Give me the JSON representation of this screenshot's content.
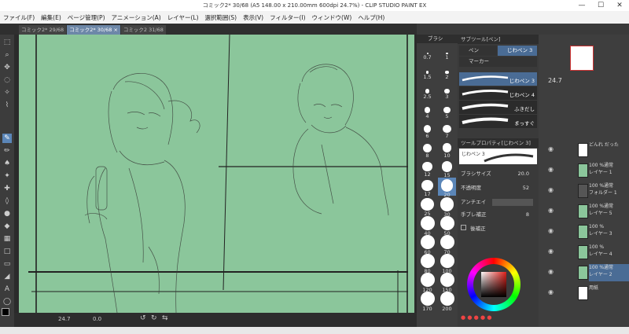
{
  "window": {
    "title": "コミック2* 30/68 (A5 148.00 x 210.00mm 600dpi 24.7%) - CLIP STUDIO PAINT EX",
    "minimize": "—",
    "maximize": "☐",
    "close": "✕"
  },
  "menu": [
    "ファイル(F)",
    "編集(E)",
    "ページ管理(P)",
    "アニメーション(A)",
    "レイヤー(L)",
    "選択範囲(S)",
    "表示(V)",
    "フィルター(I)",
    "ウィンドウ(W)",
    "ヘルプ(H)"
  ],
  "tabs": [
    {
      "label": "コミック2* 29/68"
    },
    {
      "label": "コミック2* 30/68",
      "active": true
    },
    {
      "label": "コミック2 31/68"
    }
  ],
  "tab_close": "×",
  "status": {
    "zoom": "24.7",
    "angle": "0.0"
  },
  "brush_sizes": [
    "0.7",
    "1",
    "1.5",
    "2",
    "2.5",
    "3",
    "4",
    "5",
    "6",
    "7",
    "8",
    "10",
    "12",
    "15",
    "17",
    "20",
    "25",
    "30",
    "40",
    "50",
    "60",
    "70",
    "80",
    "100",
    "120",
    "150",
    "170",
    "200"
  ],
  "brush_size_panel_label": "ブラシ",
  "subtool": {
    "panel_title": "サブツール[ペン]",
    "group_pen": "ペン",
    "group_gpen": "じわペン 3",
    "group_marker": "マーカー",
    "strokes": [
      {
        "label": "じわペン 3",
        "selected": true
      },
      {
        "label": "じわペン 4"
      },
      {
        "label": "ふきだし"
      },
      {
        "label": "まっすぐ"
      }
    ]
  },
  "tool_property": {
    "panel_title": "ツールプロパティ[じわペン 3]",
    "preview_label": "じわペン 3",
    "brush_size_label": "ブラシサイズ",
    "brush_size_value": "20.0",
    "opacity_label": "不透明度",
    "opacity_value": "52",
    "antialias_label": "アンチエイ",
    "stabilization_label": "手ブレ補正",
    "stabilization_value": "8",
    "post_correction_label": "後補正"
  },
  "layers": [
    {
      "name": "どんれ だった",
      "blend": "",
      "kind": "text"
    },
    {
      "name": "レイヤー 1",
      "blend": "100 %通常",
      "kind": "green"
    },
    {
      "name": "フォルダー 1",
      "blend": "100 %通常",
      "kind": "folder"
    },
    {
      "name": "レイヤー 5",
      "blend": "100 %通常",
      "kind": "green"
    },
    {
      "name": "レイヤー 3",
      "blend": "100 %",
      "kind": "green"
    },
    {
      "name": "レイヤー 4",
      "blend": "100 %",
      "kind": "green"
    },
    {
      "name": "レイヤー 2",
      "blend": "100 %通常",
      "kind": "green",
      "selected": true
    },
    {
      "name": "用紙",
      "blend": "",
      "kind": "paper"
    }
  ],
  "navigator_zoom": "24.7",
  "colors": {
    "canvas": "#8bc69b",
    "accent": "#5b86b8",
    "main_color": "#000000",
    "sub_color": "#ffffff"
  },
  "icons": [
    "select-icon",
    "zoom-icon",
    "move-icon",
    "lasso-icon",
    "wand-icon",
    "eyedropper-icon",
    "pen-icon",
    "pencil-icon",
    "brush-icon",
    "airbrush-icon",
    "decoration-icon",
    "eraser-icon",
    "blend-icon",
    "fill-icon",
    "gradient-icon",
    "figure-icon",
    "frame-icon",
    "ruler-icon",
    "text-icon",
    "balloon-icon",
    "line-correction-icon"
  ]
}
